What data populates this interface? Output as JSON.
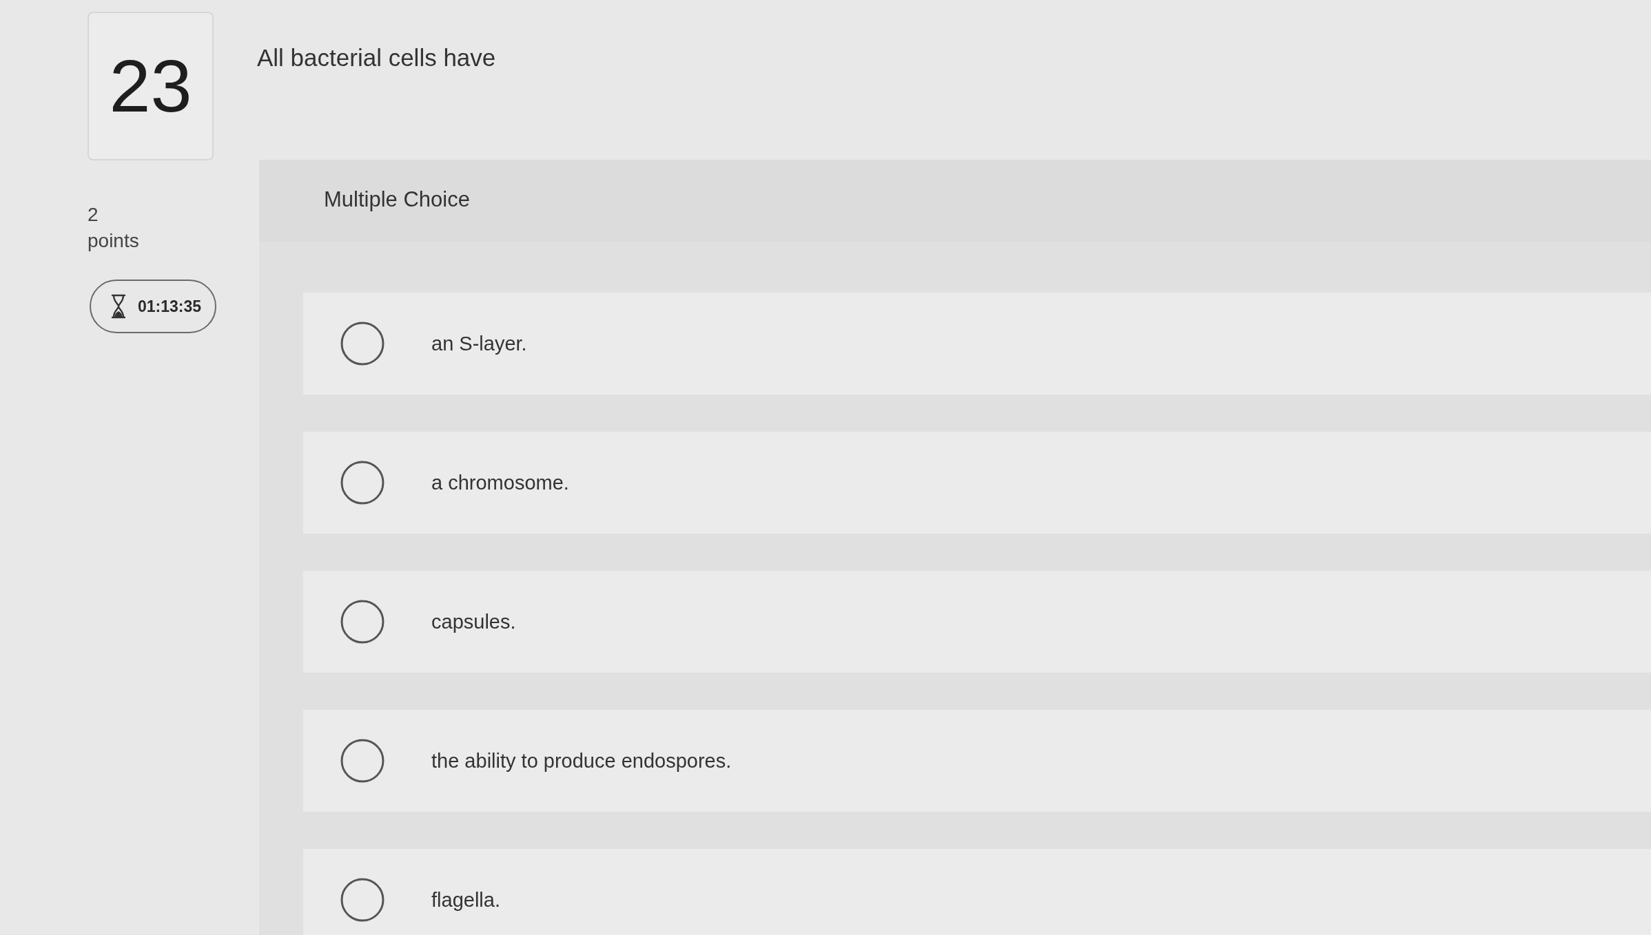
{
  "question": {
    "number": "23",
    "text": "All bacterial cells have",
    "points": "2",
    "points_label": "points",
    "timer": "01:13:35"
  },
  "answer_type": "Multiple Choice",
  "options": [
    {
      "label": "an S-layer.",
      "selected": false
    },
    {
      "label": "a chromosome.",
      "selected": false
    },
    {
      "label": "capsules.",
      "selected": false
    },
    {
      "label": "the ability to produce endospores.",
      "selected": false
    },
    {
      "label": "flagella.",
      "selected": false
    }
  ]
}
